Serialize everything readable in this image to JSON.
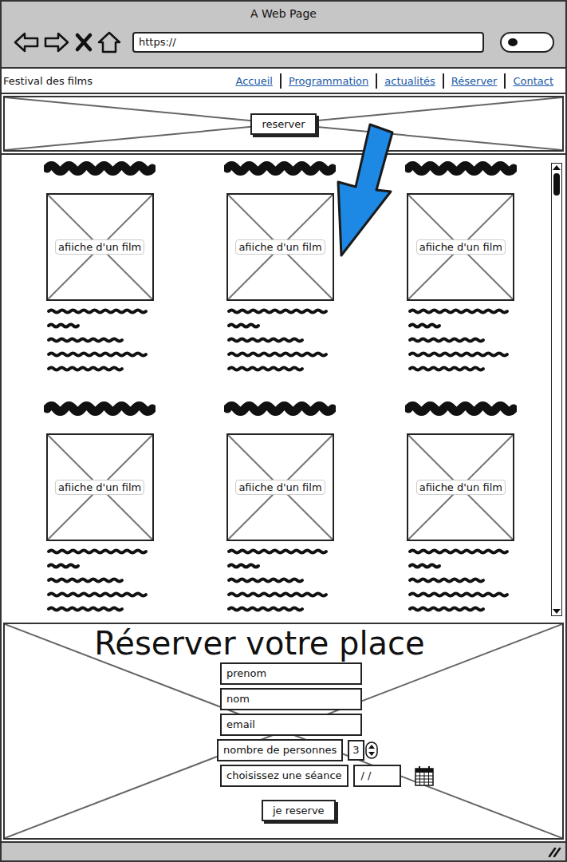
{
  "window": {
    "title": "A Web Page",
    "url": "https://"
  },
  "nav": {
    "brand": "Festival des films",
    "links": [
      "Accueil",
      "Programmation",
      "actualités",
      "Réserver",
      "Contact"
    ]
  },
  "hero": {
    "button": "reserver"
  },
  "films": [
    {
      "poster": "afiiche d'un film"
    },
    {
      "poster": "afiiche d'un film"
    },
    {
      "poster": "afiiche d'un film"
    },
    {
      "poster": "afiiche d'un film"
    },
    {
      "poster": "afiiche d'un film"
    },
    {
      "poster": "afiiche d'un film"
    }
  ],
  "booking": {
    "title": "Réserver votre place",
    "fields": [
      {
        "placeholder": "prenom"
      },
      {
        "placeholder": "nom"
      },
      {
        "placeholder": "email"
      }
    ],
    "people": {
      "label": "nombre de personnes",
      "value": "3"
    },
    "session": {
      "label": "choisissez une séance",
      "value": "/ /"
    },
    "submit": "je reserve"
  }
}
